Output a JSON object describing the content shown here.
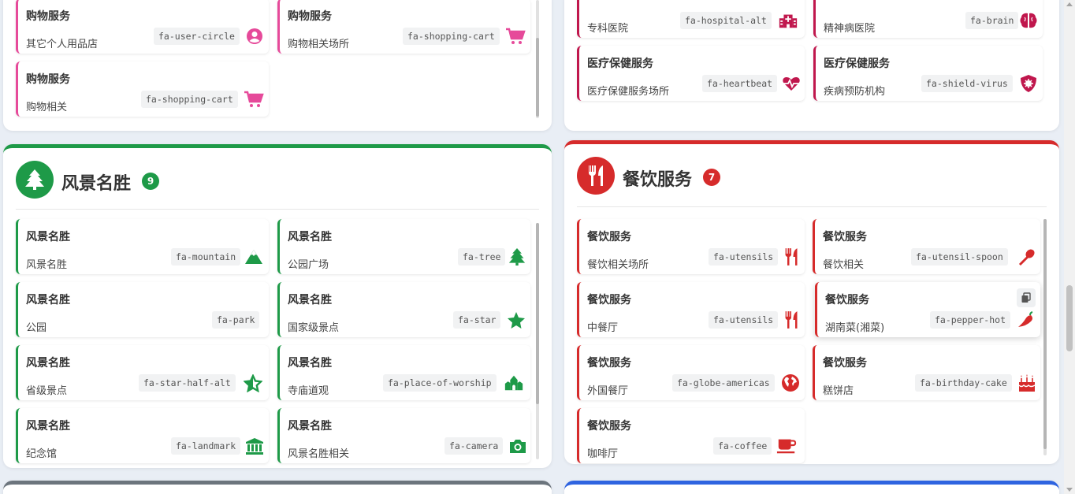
{
  "colors": {
    "green": "#1e9a48",
    "red": "#d62b2b",
    "pink": "#e64a9a",
    "crimson": "#c0174d",
    "gray": "#6c757d",
    "blue": "#2f64e0"
  },
  "shopping_panel": {
    "cards": [
      {
        "title": "购物服务",
        "sub": "其它个人用品店",
        "code": "fa-user-circle",
        "icon": "user-circle-icon"
      },
      {
        "title": "购物服务",
        "sub": "购物相关场所",
        "code": "fa-shopping-cart",
        "icon": "shopping-cart-icon"
      },
      {
        "title": "购物服务",
        "sub": "购物相关",
        "code": "fa-shopping-cart",
        "icon": "shopping-cart-icon"
      }
    ]
  },
  "medical_panel": {
    "cards": [
      {
        "title": "",
        "sub": "专科医院",
        "code": "fa-hospital-alt",
        "icon": "hospital-icon"
      },
      {
        "title": "",
        "sub": "精神病医院",
        "code": "fa-brain",
        "icon": "brain-icon"
      },
      {
        "title": "医疗保健服务",
        "sub": "医疗保健服务场所",
        "code": "fa-heartbeat",
        "icon": "heartbeat-icon"
      },
      {
        "title": "医疗保健服务",
        "sub": "疾病预防机构",
        "code": "fa-shield-virus",
        "icon": "shield-virus-icon"
      }
    ]
  },
  "scenic_panel": {
    "title": "风景名胜",
    "count": "9",
    "cards": [
      {
        "title": "风景名胜",
        "sub": "风景名胜",
        "code": "fa-mountain",
        "icon": "mountain-icon"
      },
      {
        "title": "风景名胜",
        "sub": "公园广场",
        "code": "fa-tree",
        "icon": "tree-icon"
      },
      {
        "title": "风景名胜",
        "sub": "公园",
        "code": "fa-park",
        "icon": ""
      },
      {
        "title": "风景名胜",
        "sub": "国家级景点",
        "code": "fa-star",
        "icon": "star-icon"
      },
      {
        "title": "风景名胜",
        "sub": "省级景点",
        "code": "fa-star-half-alt",
        "icon": "star-half-icon"
      },
      {
        "title": "风景名胜",
        "sub": "寺庙道观",
        "code": "fa-place-of-worship",
        "icon": "place-of-worship-icon"
      },
      {
        "title": "风景名胜",
        "sub": "纪念馆",
        "code": "fa-landmark",
        "icon": "landmark-icon"
      },
      {
        "title": "风景名胜",
        "sub": "风景名胜相关",
        "code": "fa-camera",
        "icon": "camera-icon"
      }
    ]
  },
  "dining_panel": {
    "title": "餐饮服务",
    "count": "7",
    "cards": [
      {
        "title": "餐饮服务",
        "sub": "餐饮相关场所",
        "code": "fa-utensils",
        "icon": "utensils-icon"
      },
      {
        "title": "餐饮服务",
        "sub": "餐饮相关",
        "code": "fa-utensil-spoon",
        "icon": "utensil-spoon-icon"
      },
      {
        "title": "餐饮服务",
        "sub": "中餐厅",
        "code": "fa-utensils",
        "icon": "utensils-icon"
      },
      {
        "title": "餐饮服务",
        "sub": "湖南菜(湘菜)",
        "code": "fa-pepper-hot",
        "icon": "pepper-hot-icon"
      },
      {
        "title": "餐饮服务",
        "sub": "外国餐厅",
        "code": "fa-globe-americas",
        "icon": "globe-americas-icon"
      },
      {
        "title": "餐饮服务",
        "sub": "糕饼店",
        "code": "fa-birthday-cake",
        "icon": "birthday-cake-icon"
      },
      {
        "title": "餐饮服务",
        "sub": "咖啡厅",
        "code": "fa-coffee",
        "icon": "coffee-icon"
      }
    ]
  }
}
